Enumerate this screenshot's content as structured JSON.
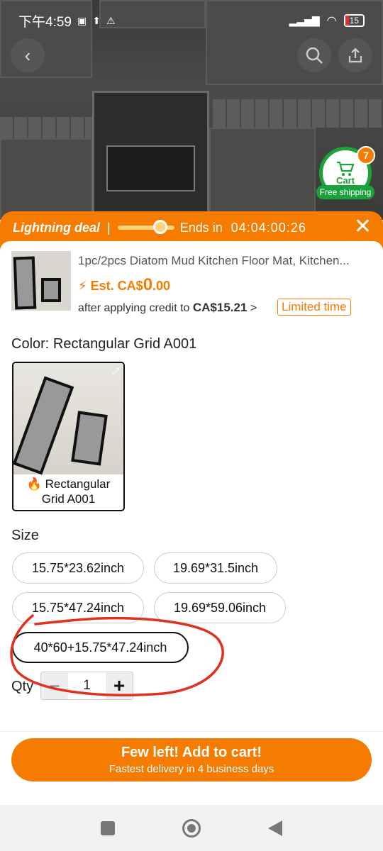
{
  "status_bar": {
    "time": "下午4:59",
    "battery": "15"
  },
  "cart": {
    "label": "Cart",
    "badge": "7",
    "free_shipping": "Free shipping"
  },
  "deal_bar": {
    "label": "Lightning deal",
    "separator": "|",
    "ends_label": "Ends in",
    "countdown": "04:04:00:26"
  },
  "product": {
    "title": "1pc/2pcs Diatom Mud Kitchen Floor Mat, Kitchen...",
    "est_prefix": "Est. CA$",
    "est_big": "0",
    "est_small": ".00",
    "credit_text": "after applying credit to",
    "credit_price": "CA$15.21",
    "credit_chevron": ">",
    "limited_badge": "Limited time"
  },
  "color": {
    "title": "Color: Rectangular Grid A001",
    "swatch_label_line1": "Rectangular",
    "swatch_label_line2": "Grid A001"
  },
  "size": {
    "title": "Size",
    "options": [
      "15.75*23.62inch",
      "19.69*31.5inch",
      "15.75*47.24inch",
      "19.69*59.06inch",
      "40*60+15.75*47.24inch"
    ],
    "selected_index": 4
  },
  "qty": {
    "label": "Qty",
    "value": "1",
    "minus": "−",
    "plus": "+"
  },
  "cta": {
    "line1": "Few left! Add to cart!",
    "line2": "Fastest delivery in 4 business days"
  },
  "colors": {
    "accent": "#f57c00",
    "cart_green": "#1aa33a",
    "annotation_red": "#e0301e"
  }
}
